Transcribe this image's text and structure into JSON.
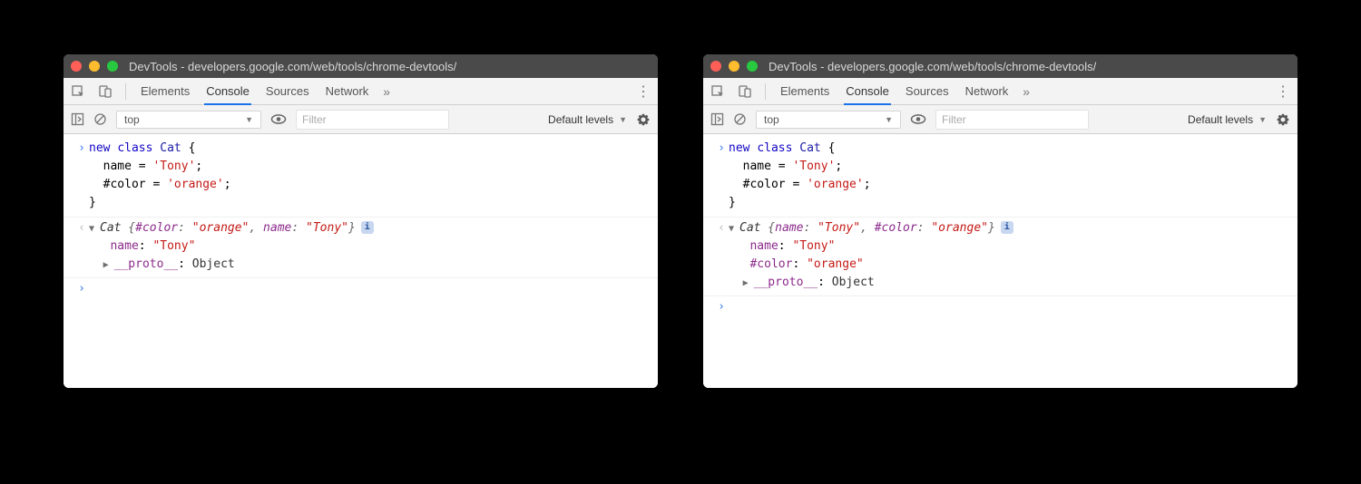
{
  "left": {
    "title": "DevTools - developers.google.com/web/tools/chrome-devtools/",
    "tabs": {
      "elements": "Elements",
      "console": "Console",
      "sources": "Sources",
      "network": "Network"
    },
    "toolbar": {
      "context": "top",
      "filter_placeholder": "Filter",
      "levels": "Default levels"
    },
    "input_code": "new class Cat {\n  name = 'Tony';\n  #color = 'orange';\n}",
    "output": {
      "class_name": "Cat",
      "preview_props": [
        {
          "key": "#color",
          "value": "\"orange\""
        },
        {
          "key": "name",
          "value": "\"Tony\""
        }
      ],
      "expanded": [
        {
          "key": "name",
          "value": "\"Tony\""
        }
      ],
      "proto": {
        "label": "__proto__",
        "value": "Object"
      }
    }
  },
  "right": {
    "title": "DevTools - developers.google.com/web/tools/chrome-devtools/",
    "tabs": {
      "elements": "Elements",
      "console": "Console",
      "sources": "Sources",
      "network": "Network"
    },
    "toolbar": {
      "context": "top",
      "filter_placeholder": "Filter",
      "levels": "Default levels"
    },
    "input_code": "new class Cat {\n  name = 'Tony';\n  #color = 'orange';\n}",
    "output": {
      "class_name": "Cat",
      "preview_props": [
        {
          "key": "name",
          "value": "\"Tony\""
        },
        {
          "key": "#color",
          "value": "\"orange\""
        }
      ],
      "expanded": [
        {
          "key": "name",
          "value": "\"Tony\""
        },
        {
          "key": "#color",
          "value": "\"orange\""
        }
      ],
      "proto": {
        "label": "__proto__",
        "value": "Object"
      }
    }
  }
}
